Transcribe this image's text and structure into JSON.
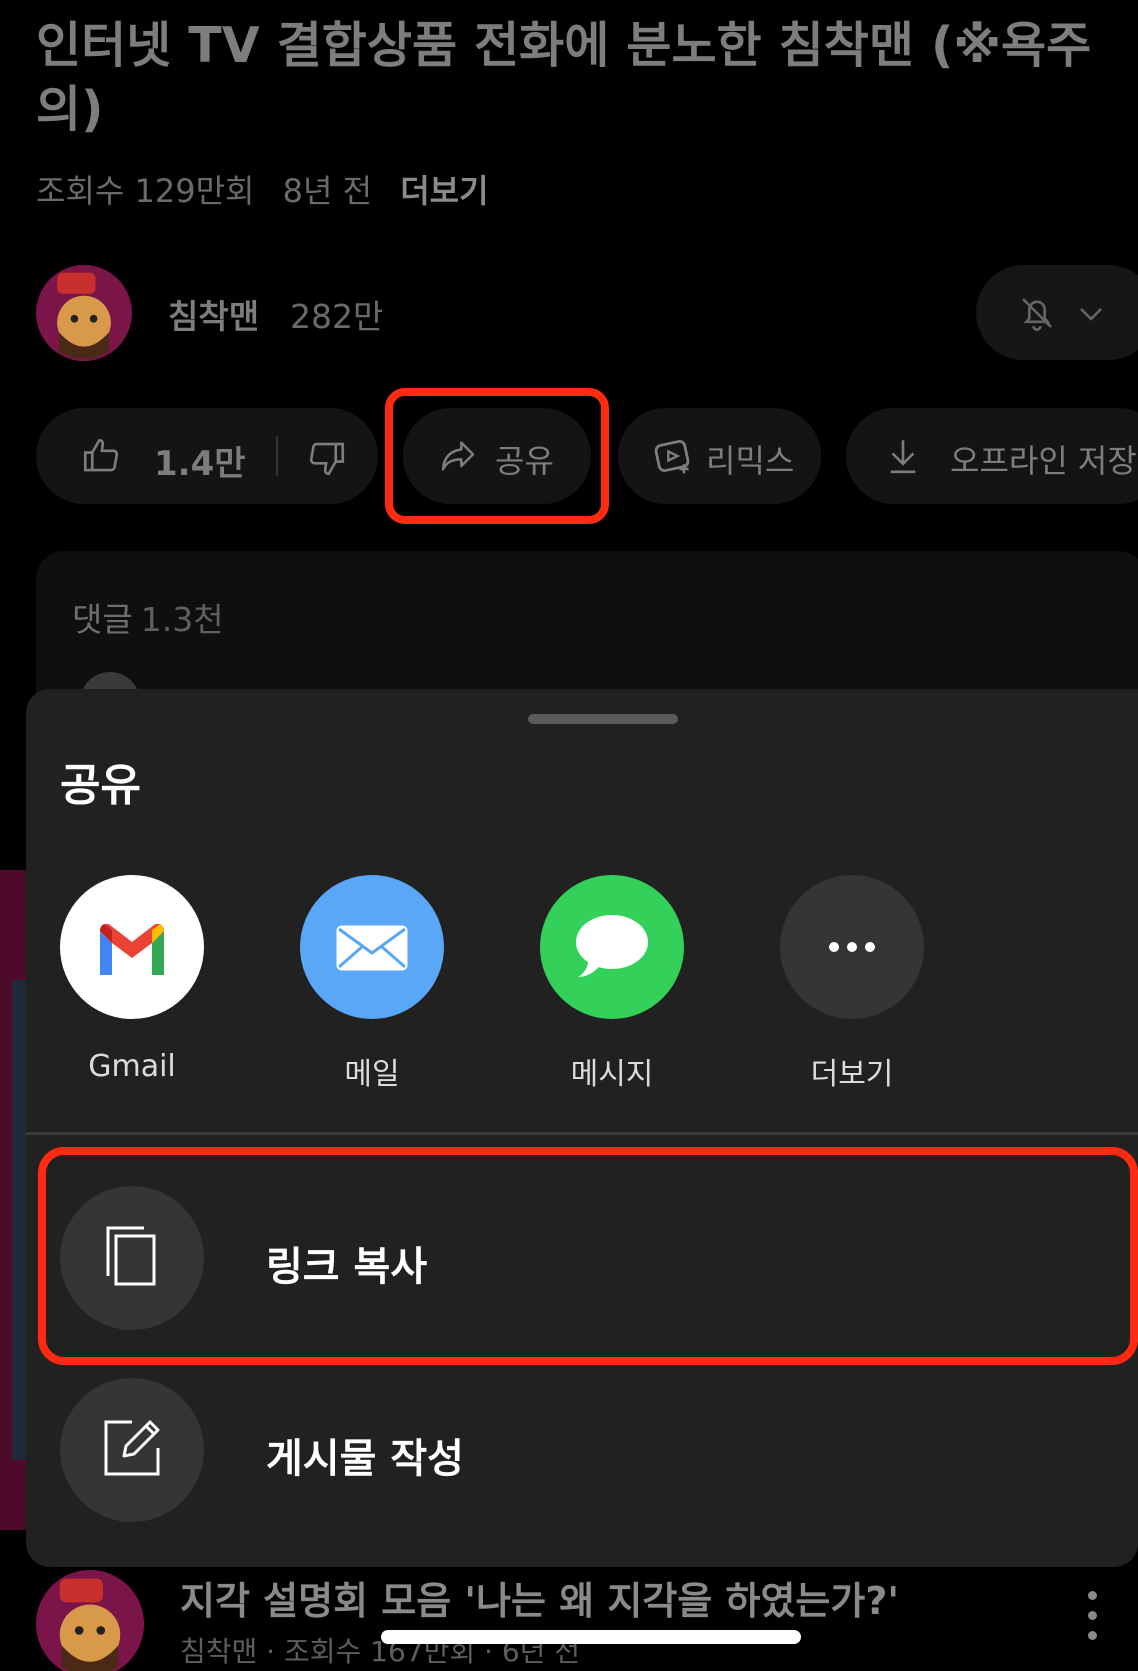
{
  "video": {
    "title": "인터넷 TV 결합상품 전화에 분노한 침착맨 (※욕주의)",
    "views": "조회수 129만회",
    "age": "8년 전",
    "more_label": "더보기"
  },
  "channel": {
    "name": "침착맨",
    "subscribers": "282만"
  },
  "actions": {
    "like_count": "1.4만",
    "share_label": "공유",
    "remix_label": "리믹스",
    "download_label": "오프라인 저장"
  },
  "comments": {
    "label": "댓글",
    "count": "1.3천"
  },
  "share_sheet": {
    "title": "공유",
    "apps": [
      {
        "label": "Gmail",
        "icon": "gmail-icon"
      },
      {
        "label": "메일",
        "icon": "mail-icon"
      },
      {
        "label": "메시지",
        "icon": "messages-icon"
      },
      {
        "label": "더보기",
        "icon": "more-icon"
      }
    ],
    "copy_link_label": "링크 복사",
    "create_post_label": "게시물 작성"
  },
  "next_video": {
    "title": "지각 설명회 모음 '나는 왜 지각을 하였는가?'",
    "meta": "침착맨 · 조회수 167만회 · 6년 전"
  },
  "colors": {
    "highlight": "#ff2a12",
    "sheet_bg": "#212121",
    "mail_blue": "#5aa6f7",
    "messages_green": "#33d15a"
  }
}
